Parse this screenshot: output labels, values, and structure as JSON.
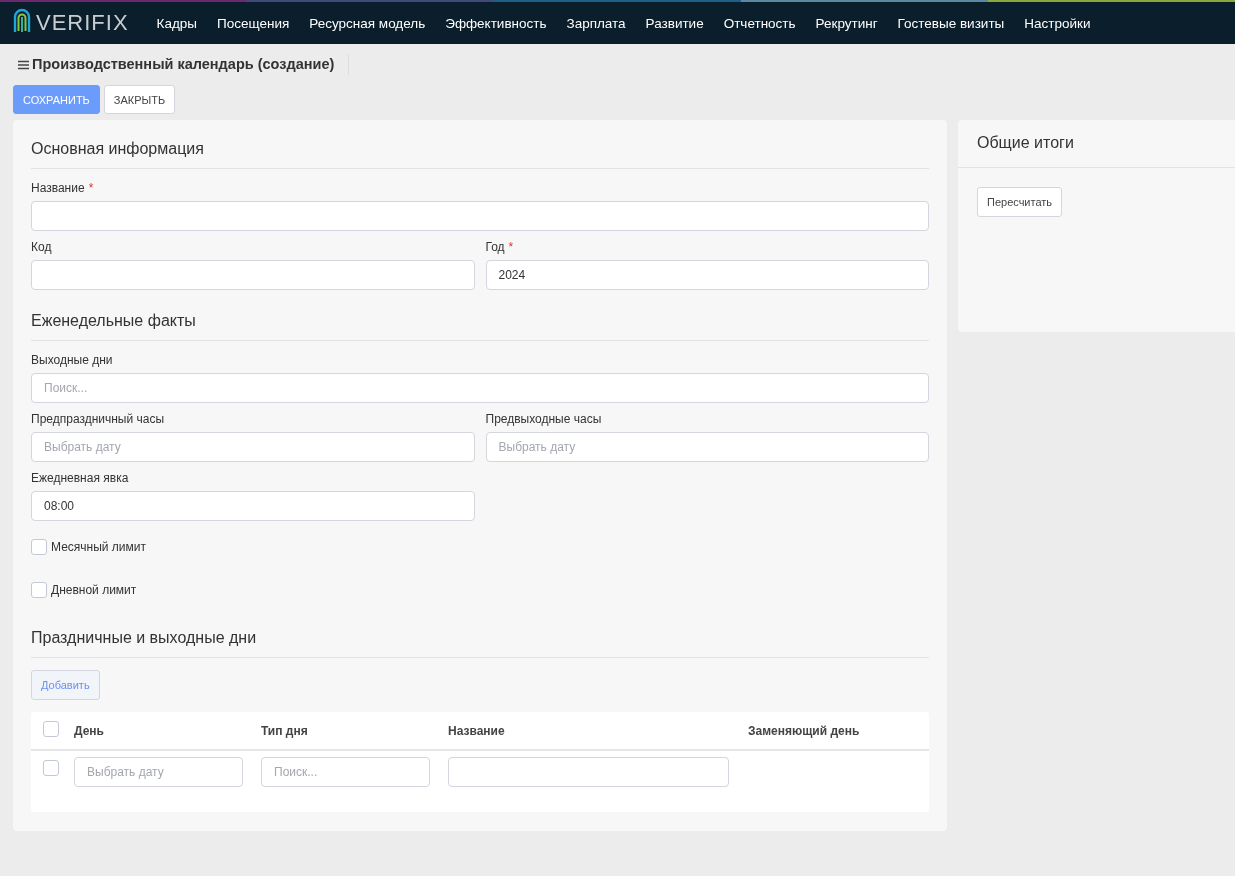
{
  "nav": {
    "logo": "VERIFIX",
    "items": [
      {
        "label": "Кадры"
      },
      {
        "label": "Посещения"
      },
      {
        "label": "Ресурсная модель"
      },
      {
        "label": "Эффективность"
      },
      {
        "label": "Зарплата"
      },
      {
        "label": "Развитие"
      },
      {
        "label": "Отчетность"
      },
      {
        "label": "Рекрутинг"
      },
      {
        "label": "Гостевые визиты"
      },
      {
        "label": "Настройки"
      }
    ]
  },
  "page": {
    "title": "Производственный календарь (создание)"
  },
  "actions": [
    {
      "label": "СОХРАНИТЬ",
      "kind": "primary"
    },
    {
      "label": "ЗАКРЫТЬ",
      "kind": "default"
    }
  ],
  "form": {
    "sections": [
      {
        "title": "Основная информация",
        "rows": [
          [
            {
              "kind": "input",
              "label": "Название",
              "required_mark": "*",
              "wide": true
            }
          ],
          [
            {
              "kind": "input",
              "label": "Код"
            },
            {
              "kind": "input",
              "label": "Год",
              "required_mark": "*",
              "value": "2024"
            }
          ]
        ]
      },
      {
        "title": "Еженедельные факты",
        "rows": [
          [
            {
              "kind": "input",
              "label": "Выходные дни",
              "wide": true,
              "placeholder": "Поиск..."
            }
          ],
          [
            {
              "kind": "input",
              "label": "Предпраздничный часы",
              "placeholder": "Выбрать дату"
            },
            {
              "kind": "input",
              "label": "Предвыходные часы",
              "placeholder": "Выбрать дату"
            }
          ],
          [
            {
              "kind": "input",
              "label": "Ежедневная явка",
              "value": "08:00"
            }
          ],
          [
            {
              "kind": "checkbox",
              "label": "Месячный лимит",
              "checked": false
            }
          ],
          [
            {
              "kind": "checkbox",
              "label": "Дневной лимит",
              "checked": false
            }
          ]
        ]
      },
      {
        "title": "Праздничные и выходные дни",
        "add_button": "Добавить",
        "table": {
          "all_checked": false,
          "columns": [
            "День",
            "Тип дня",
            "Название",
            "Заменяющий день"
          ],
          "rows": [
            {
              "checked": false,
              "cells": [
                {
                  "kind": "input",
                  "placeholder": "Выбрать дату"
                },
                {
                  "kind": "input",
                  "placeholder": "Поиск..."
                },
                {
                  "kind": "input"
                },
                {
                  "kind": "empty"
                }
              ]
            }
          ]
        }
      }
    ]
  },
  "summary": {
    "title": "Общие итоги",
    "button": "Пересчитать"
  }
}
